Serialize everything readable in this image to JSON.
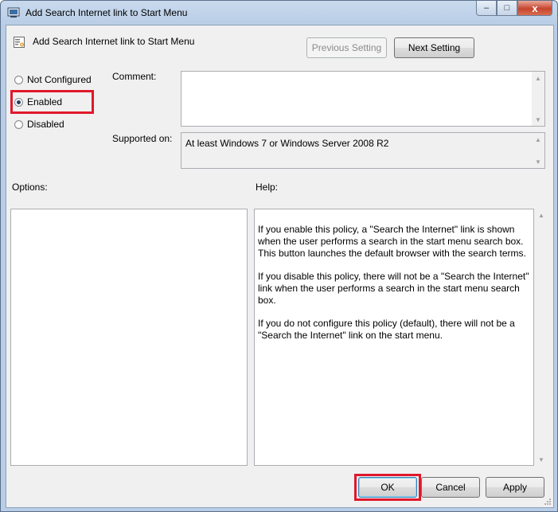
{
  "window": {
    "title": "Add Search Internet link to Start Menu",
    "controls": {
      "minimize": "–",
      "maximize": "□",
      "close": "x"
    }
  },
  "header": {
    "policy_name": "Add Search Internet link to Start Menu",
    "previous_label": "Previous Setting",
    "next_label": "Next Setting"
  },
  "state": {
    "options": [
      {
        "label": "Not Configured",
        "checked": false
      },
      {
        "label": "Enabled",
        "checked": true
      },
      {
        "label": "Disabled",
        "checked": false
      }
    ]
  },
  "comment": {
    "label": "Comment:",
    "value": ""
  },
  "supported": {
    "label": "Supported on:",
    "value": "At least Windows 7 or Windows Server 2008 R2"
  },
  "options_panel": {
    "label": "Options:"
  },
  "help": {
    "label": "Help:",
    "paragraphs": [
      "If you enable this policy, a \"Search the Internet\" link is shown when the user performs a search in the start menu search box. This button launches the default browser with the search terms.",
      "If you disable this policy, there will not be a \"Search the Internet\" link when the user performs a search in the start menu search box.",
      "If you do not configure this policy (default), there will not be a \"Search the Internet\" link on the start menu."
    ]
  },
  "footer": {
    "ok_label": "OK",
    "cancel_label": "Cancel",
    "apply_label": "Apply"
  },
  "colors": {
    "highlight": "#e0182b",
    "title_bg": "#b9cde6",
    "close": "#c7452f"
  }
}
